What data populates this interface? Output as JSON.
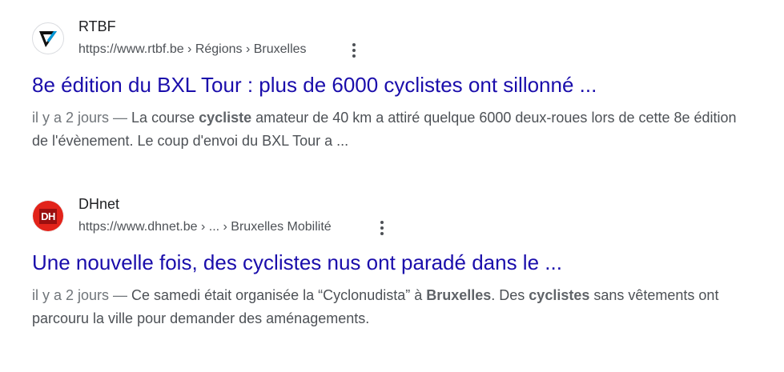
{
  "results": [
    {
      "site_name": "RTBF",
      "url": "https://www.rtbf.be › Régions › Bruxelles",
      "title": "8e édition du BXL Tour : plus de 6000 cyclistes ont sillonné ...",
      "date": "il y a 2 jours — ",
      "snippet_parts": [
        "La course ",
        "cycliste",
        " amateur de 40 km a attiré quelque 6000 deux-roues lors de cette 8e édition de l'évènement. Le coup d'envoi du BXL Tour a ..."
      ],
      "favicon_icon": "rtbf-logo-icon",
      "more_icon": "more-vert-icon"
    },
    {
      "site_name": "DHnet",
      "url": "https://www.dhnet.be › ... › Bruxelles Mobilité",
      "title": "Une nouvelle fois, des cyclistes nus ont paradé dans le ...",
      "date": "il y a 2 jours — ",
      "snippet_parts": [
        "Ce samedi était organisée la “Cyclonudista” à ",
        "Bruxelles",
        ". Des ",
        "cyclistes",
        " sans vêtements ont parcouru la ville pour demander des aménagements."
      ],
      "favicon_text": "DH",
      "favicon_icon": "dhnet-logo-icon",
      "more_icon": "more-vert-icon"
    }
  ],
  "colors": {
    "link": "#1a0dab",
    "snippet": "#4d5156",
    "dh_red": "#e2231a",
    "rtbf_blue": "#0097d8"
  }
}
